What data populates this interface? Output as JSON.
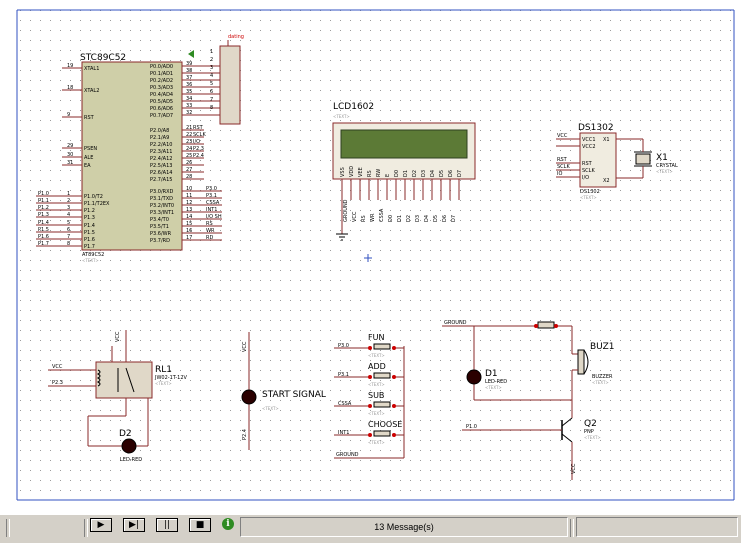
{
  "components": {
    "mcu": {
      "name": "STC89C52",
      "part": "AT89C52",
      "text": "<TEXT>",
      "left_pins": [
        "XTAL1",
        "XTAL2",
        "RST",
        "PSEN",
        "ALE",
        "EA",
        "P1.0/T2",
        "P1.1/T2EX",
        "P1.2",
        "P1.3",
        "P1.4",
        "P1.5",
        "P1.6",
        "P1.7"
      ],
      "left_nums": [
        "19",
        "18",
        "9",
        "29",
        "30",
        "31",
        "1",
        "2",
        "3",
        "4",
        "5",
        "6",
        "7",
        "8"
      ],
      "right_pins": [
        "P0.0/AD0",
        "P0.1/AD1",
        "P0.2/AD2",
        "P0.3/AD3",
        "P0.4/AD4",
        "P0.5/AD5",
        "P0.6/AD6",
        "P0.7/AD7",
        "P2.0/A8",
        "P2.1/A9",
        "P2.2/A10",
        "P2.3/A11",
        "P2.4/A12",
        "P2.5/A13",
        "P2.6/A14",
        "P2.7/A15",
        "P3.0/RXD",
        "P3.1/TXD",
        "P3.2/INT0",
        "P3.3/INT1",
        "P3.4/T0",
        "P3.5/T1",
        "P3.6/WR",
        "P3.7/RD"
      ],
      "right_nums": [
        "39",
        "38",
        "37",
        "36",
        "35",
        "34",
        "33",
        "32",
        "21",
        "22",
        "23",
        "24",
        "25",
        "26",
        "27",
        "28",
        "10",
        "11",
        "12",
        "13",
        "14",
        "15",
        "16",
        "17"
      ],
      "p2_nets": [
        "RST",
        "SCLK",
        "I/O",
        "P2.3",
        "P2.4"
      ],
      "p3_nets": [
        "P3.0",
        "P3.1",
        "CSSA",
        "INT1",
        "I/O SH",
        "RS",
        "WR",
        "RD"
      ],
      "p1_nets": [
        "P1.0",
        "P1.1",
        "P1.2",
        "P1.3",
        "P1.4",
        "P1.5",
        "P1.6",
        "P1.7"
      ]
    },
    "header": {
      "label": "dating",
      "pins": [
        "1",
        "2",
        "3",
        "4",
        "5",
        "6",
        "7",
        "8"
      ]
    },
    "lcd": {
      "name": "LCD1602",
      "text": "<TEXT>",
      "pins": [
        "VSS",
        "VDD",
        "VEE",
        "RS",
        "RW",
        "E",
        "D0",
        "D1",
        "D2",
        "D3",
        "D4",
        "D5",
        "D6",
        "D7"
      ],
      "nets": [
        "GROUND",
        "VCC",
        "RS",
        "WR",
        "CSSA",
        "D0",
        "D1",
        "D2",
        "D3",
        "D4",
        "D5",
        "D6",
        "D7"
      ]
    },
    "rtc": {
      "name": "DS1302",
      "part": "DS1302",
      "text": "<TEXT>",
      "pins": [
        "VCC1",
        "VCC2",
        "RST",
        "SCLK",
        "I/O",
        "X1",
        "X2"
      ],
      "nets": [
        "VCC",
        "RST",
        "SCLK",
        "IO"
      ]
    },
    "crystal": {
      "name": "X1",
      "part": "CRYSTAL",
      "text": "<TEXT>"
    },
    "relay": {
      "name": "RL1",
      "part": "JW02-1T-12V",
      "text": "<TEXT>",
      "nets": [
        "VCC",
        "P2.3",
        "VCC"
      ]
    },
    "led2": {
      "name": "D2",
      "part": "LED-RED"
    },
    "start": {
      "label": "START SIGNAL",
      "text": "<TEXT>",
      "nets": [
        "VCC",
        "P2.4"
      ]
    },
    "buttons": [
      {
        "name": "FUN",
        "net": "P3.0"
      },
      {
        "name": "ADD",
        "net": "P3.1"
      },
      {
        "name": "SUB",
        "net": "CSSA"
      },
      {
        "name": "CHOOSE",
        "net": "INT1"
      }
    ],
    "button_gnd": "GROUND",
    "led1": {
      "name": "D1",
      "part": "LED-RED",
      "text": "<TEXT>"
    },
    "buzzer": {
      "name": "BUZ1",
      "part": "BUZZER",
      "text": "<TEXT>"
    },
    "transistor": {
      "name": "Q2",
      "part": "PNP",
      "text": "<TEXT>",
      "nets": [
        "GROUND",
        "P1.0",
        "VCC"
      ]
    }
  },
  "status": {
    "play": "▶",
    "step": "▶|",
    "pause": "||",
    "stop": "■",
    "info": "i",
    "messages": "13 Message(s)"
  }
}
